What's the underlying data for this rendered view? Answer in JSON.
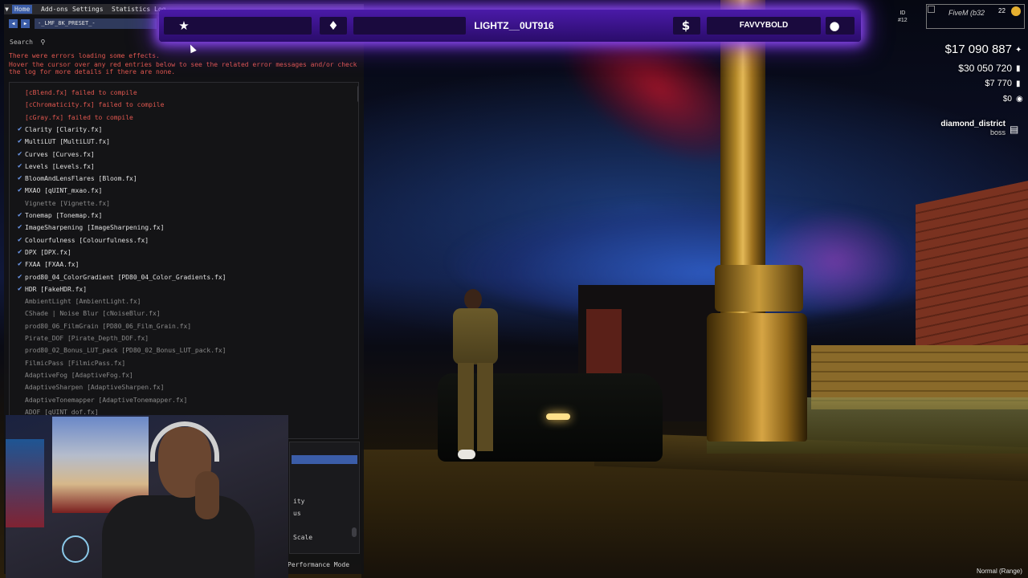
{
  "reshade": {
    "tabs": [
      {
        "label": "Home",
        "active": true
      },
      {
        "label": "Add-ons",
        "active": false
      },
      {
        "label": "Settings",
        "active": false
      },
      {
        "label": "Statistics",
        "active": false
      },
      {
        "label": "Log",
        "active": false
      }
    ],
    "preset": "-_LMF_8K_PRESET_-",
    "search_label": "Search",
    "errors": [
      "There were errors loading some effects.",
      "Hover the cursor over any red entries below to see the related error messages and/or check",
      "the log for more details if there are none."
    ],
    "effects": [
      {
        "label": "[cBlend.fx] failed to compile",
        "state": "error"
      },
      {
        "label": "[cChromaticity.fx] failed to compile",
        "state": "error"
      },
      {
        "label": "[cGray.fx] failed to compile",
        "state": "error"
      },
      {
        "label": "Clarity [Clarity.fx]",
        "state": "on"
      },
      {
        "label": "MultiLUT [MultiLUT.fx]",
        "state": "on"
      },
      {
        "label": "Curves [Curves.fx]",
        "state": "on"
      },
      {
        "label": "Levels [Levels.fx]",
        "state": "on"
      },
      {
        "label": "BloomAndLensFlares [Bloom.fx]",
        "state": "on"
      },
      {
        "label": "MXAO [qUINT_mxao.fx]",
        "state": "on"
      },
      {
        "label": "Vignette [Vignette.fx]",
        "state": "off"
      },
      {
        "label": "Tonemap [Tonemap.fx]",
        "state": "on"
      },
      {
        "label": "ImageSharpening [ImageSharpening.fx]",
        "state": "on"
      },
      {
        "label": "Colourfulness [Colourfulness.fx]",
        "state": "on"
      },
      {
        "label": "DPX [DPX.fx]",
        "state": "on"
      },
      {
        "label": "FXAA [FXAA.fx]",
        "state": "on"
      },
      {
        "label": "prod80_04_ColorGradient [PD80_04_Color_Gradients.fx]",
        "state": "on"
      },
      {
        "label": "HDR [FakeHDR.fx]",
        "state": "on"
      },
      {
        "label": "AmbientLight [AmbientLight.fx]",
        "state": "off"
      },
      {
        "label": "CShade | Noise Blur [cNoiseBlur.fx]",
        "state": "off"
      },
      {
        "label": "prod80_06_FilmGrain [PD80_06_Film_Grain.fx]",
        "state": "off"
      },
      {
        "label": "Pirate_DOF [Pirate_Depth_DOF.fx]",
        "state": "off"
      },
      {
        "label": "prod80_02_Bonus_LUT_pack [PD80_02_Bonus_LUT_pack.fx]",
        "state": "off"
      },
      {
        "label": "FilmicPass [FilmicPass.fx]",
        "state": "off"
      },
      {
        "label": "AdaptiveFog [AdaptiveFog.fx]",
        "state": "off"
      },
      {
        "label": "AdaptiveSharpen [AdaptiveSharpen.fx]",
        "state": "off"
      },
      {
        "label": "AdaptiveTonemapper [AdaptiveTonemapper.fx]",
        "state": "off"
      },
      {
        "label": "ADOF [qUINT_dof.fx]",
        "state": "off"
      }
    ],
    "lower_panel": [
      "ity",
      "us",
      "Scale"
    ],
    "performance_mode": "Performance Mode",
    "colors": {
      "accent": "#3b5da8",
      "error": "#e0574f",
      "check": "#6f9cf2"
    }
  },
  "hud": {
    "left_icon": "star-icon",
    "second_icon": "diamond-icon",
    "player_name": "LIGHTZ__0UT916",
    "money_icon": "dollar-icon",
    "partner_name": "FAVVYBOLD",
    "profile_icon": "user-icon",
    "glow_color": "#8a4cff"
  },
  "right_hud": {
    "id_label": "ID",
    "id_value": "#12",
    "fivem_text": "FiveM (b32",
    "players_count": "22",
    "cash": "$17 090 887",
    "bank": "$30 050 720",
    "dirty": "$7 770",
    "other": "$0",
    "job": "diamond_district",
    "grade": "boss"
  },
  "mode_label": "Normal (Range)"
}
